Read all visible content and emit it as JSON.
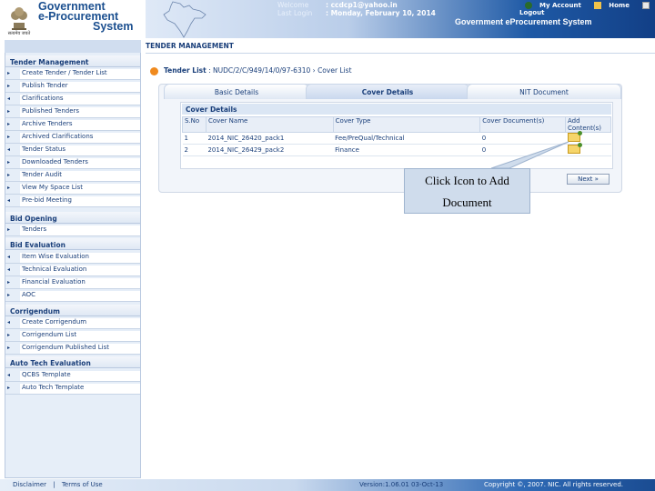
{
  "header": {
    "logo_line1": "Government",
    "logo_line2": "e-Procurement",
    "logo_line3": "System",
    "emblem_label": "सत्यमेव जयते",
    "welcome_label": "Welcome",
    "welcome_value": ": ccdcp1@yahoo.in",
    "last_login_label": "Last Login",
    "last_login_value": ": Monday, February 10, 2014",
    "my_account": "My Account",
    "home": "Home",
    "logout": "Logout",
    "system_title": "Government eProcurement System",
    "brand_color": "#1b4f8f"
  },
  "sidebar": {
    "sections": [
      {
        "title": "Tender Management",
        "items": [
          "Create Tender / Tender List",
          "Publish Tender",
          "Clarifications",
          "Published Tenders",
          "Archive Tenders",
          "Archived Clarifications",
          "Tender Status",
          "Downloaded Tenders",
          "Tender Audit",
          "View My Space List",
          "Pre-bid Meeting"
        ]
      },
      {
        "title": "Bid Opening",
        "items": [
          "Tenders"
        ]
      },
      {
        "title": "Bid Evaluation",
        "items": [
          "Item Wise Evaluation",
          "Technical Evaluation",
          "Financial Evaluation",
          "AOC"
        ]
      },
      {
        "title": "Corrigendum",
        "items": [
          "Create Corrigendum",
          "Corrigendum List",
          "Corrigendum Published List"
        ]
      },
      {
        "title": "Auto Tech Evaluation",
        "items": [
          "QCBS Template",
          "Auto Tech Template"
        ]
      }
    ]
  },
  "main": {
    "title": "TENDER MANAGEMENT",
    "breadcrumb_root": "Tender List",
    "breadcrumb_ref": ": NUDC/2/C/949/14/0/97-6310",
    "breadcrumb_sep": "›",
    "breadcrumb_leaf": "Cover List",
    "tabs": [
      "Basic Details",
      "Cover Details",
      "NIT Document"
    ],
    "active_tab": "Cover Details",
    "cover_details_title": "Cover Details",
    "table": {
      "headers": [
        "S.No",
        "Cover Name",
        "Cover Type",
        "Cover Document(s)",
        "Add Content(s)"
      ],
      "rows": [
        [
          "1",
          "2014_NIC_26420_pack1",
          "Fee/PreQual/Technical",
          "0"
        ],
        [
          "2",
          "2014_NIC_26429_pack2",
          "Finance",
          "0"
        ]
      ]
    },
    "next_button": "Next »",
    "callout_text_line1": "Click Icon to Add",
    "callout_text_line2": "Document"
  },
  "footer": {
    "disclaimer": "Disclaimer",
    "separator": "|",
    "terms": "Terms of Use",
    "version": "Version:1.06.01 03-Oct-13",
    "copyright": "Copyright ©, 2007. NIC. All rights reserved."
  }
}
